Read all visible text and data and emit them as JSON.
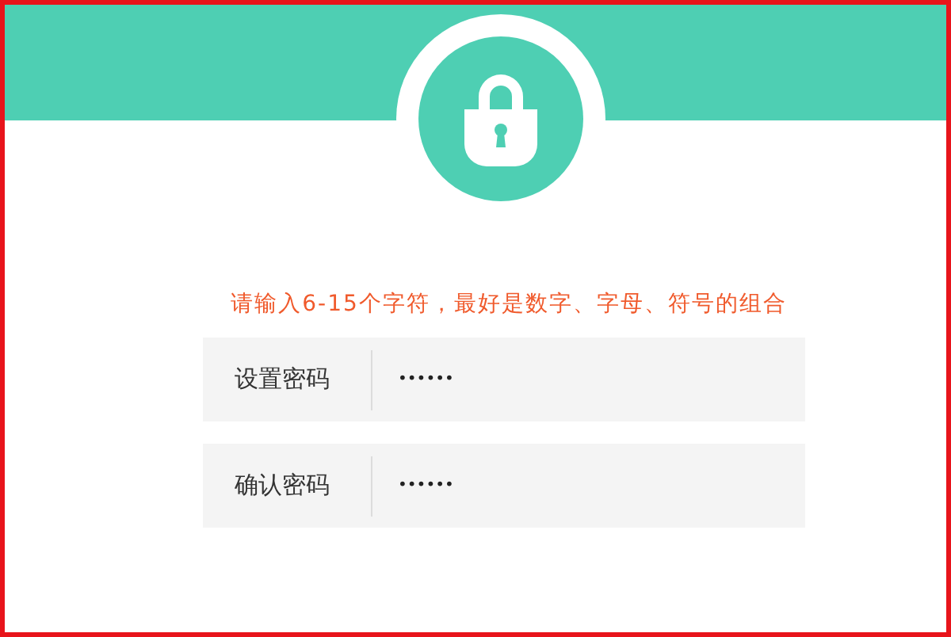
{
  "hint": "请输入6-15个字符，最好是数字、字母、符号的组合",
  "fields": [
    {
      "label": "设置密码",
      "value": "••••••"
    },
    {
      "label": "确认密码",
      "value": "••••••"
    }
  ]
}
